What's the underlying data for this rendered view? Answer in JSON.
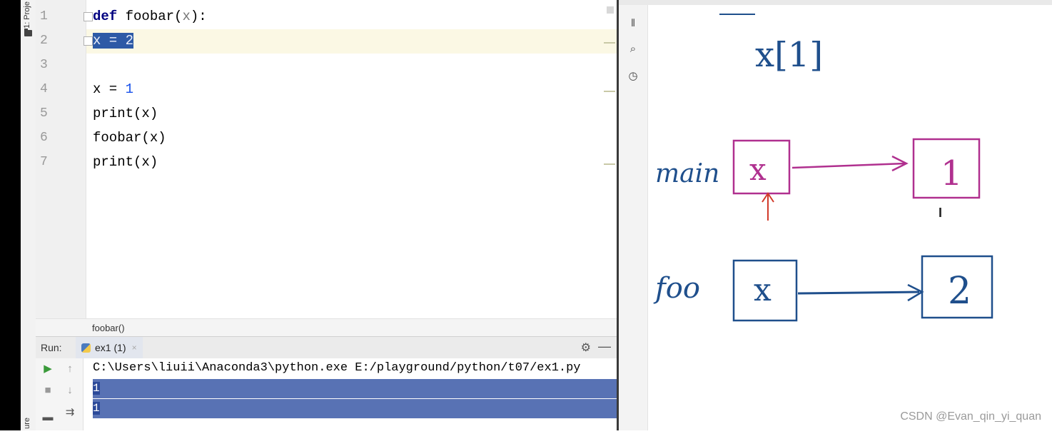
{
  "tool_window": {
    "project_label": "1: Proje",
    "structure_label": "ure"
  },
  "editor": {
    "line_numbers": [
      "1",
      "2",
      "3",
      "4",
      "5",
      "6",
      "7"
    ],
    "lines": {
      "l1": {
        "kw": "def",
        "rest": " foobar(",
        "param": "x",
        "end": "):"
      },
      "l2": {
        "selected": "x = 2"
      },
      "l4": {
        "a": "x = ",
        "num": "1"
      },
      "l5": "print(x)",
      "l6": "foobar(x)",
      "l7": "print(x)"
    }
  },
  "breadcrumb": {
    "text": "foobar()"
  },
  "run_panel": {
    "label": "Run:",
    "tab_label": "ex1 (1)",
    "tab_close": "×",
    "settings_icon": "gear-icon",
    "command": "C:\\Users\\liuii\\Anaconda3\\python.exe E:/playground/python/t07/ex1.py",
    "output": [
      "1",
      "1"
    ]
  },
  "drawing": {
    "top_note": "x[1]",
    "main_label": "main",
    "main_var": "x",
    "main_value": "1",
    "foo_label": "foo",
    "foo_var": "x",
    "foo_value": "2",
    "cursor": "I",
    "colors": {
      "magenta": "#b0308f",
      "blue": "#1f4f8c",
      "red": "#d23a2a"
    }
  },
  "watermark": "CSDN @Evan_qin_yi_quan"
}
